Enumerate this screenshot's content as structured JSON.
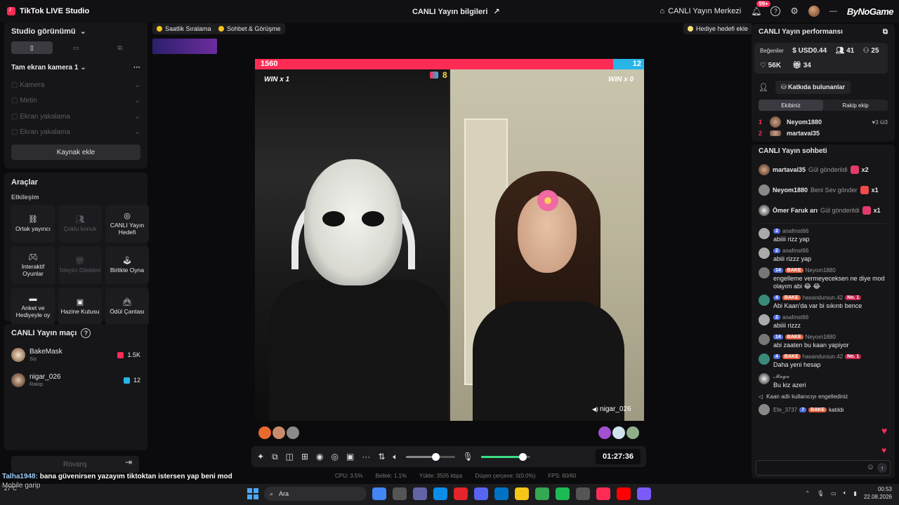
{
  "app": {
    "title": "TikTok LIVE Studio",
    "center_title": "CANLI Yayın bilgileri",
    "center_link": "CANLI Yayın Merkezi",
    "notif_badge": "99+",
    "watermark": "ByNoGame"
  },
  "studio": {
    "title": "Studio görünümü",
    "scene": "Tam ekran kamera 1",
    "sources": [
      "Kamera",
      "Metin",
      "Ekran yakalama",
      "Ekran yakalama"
    ],
    "add_source": "Kaynak ekle"
  },
  "tools": {
    "title": "Araçlar",
    "section": "Etkileşim",
    "items": [
      {
        "label": "Ortak yayıncı",
        "enabled": true,
        "icon": "link-icon"
      },
      {
        "label": "Çoklu konuk",
        "enabled": false,
        "icon": "users-icon"
      },
      {
        "label": "CANLI Yayın Hedefi",
        "enabled": true,
        "icon": "target-icon"
      },
      {
        "label": "İnteraktif Oyunlar",
        "enabled": true,
        "icon": "gamepad-icon"
      },
      {
        "label": "İzleyici Dilekleri",
        "enabled": false,
        "icon": "gift-icon"
      },
      {
        "label": "Birlikte Oyna",
        "enabled": true,
        "icon": "joystick-icon"
      },
      {
        "label": "Anket ve Hediyeyle oy",
        "enabled": true,
        "icon": "poll-icon"
      },
      {
        "label": "Hazine Kutusu",
        "enabled": true,
        "icon": "treasure-icon"
      },
      {
        "label": "Ödül Çantası",
        "enabled": true,
        "icon": "bag-icon"
      }
    ]
  },
  "match": {
    "title": "CANLI Yayın maçı",
    "players": [
      {
        "name": "BakeMask",
        "role": "Siz",
        "score": "1.5K",
        "color": "#fe2c55"
      },
      {
        "name": "nigar_026",
        "role": "Rakip",
        "score": "12",
        "color": "#27b5e8"
      }
    ],
    "rematch": "Rövanş"
  },
  "chips": {
    "hourly": "Saatlik Sıralama",
    "chat": "Sohbet & Görüşme",
    "gift_goal": "Hediye hedefi ekle"
  },
  "battle": {
    "score_left": "1560",
    "score_right": "12",
    "left_share": 0.92,
    "mid_count": "8",
    "win_left": "WIN x 1",
    "win_right": "WIN x 0",
    "guest_name": "nigar_026"
  },
  "controls": {
    "timer": "01:27:36",
    "volume_level": 0.6,
    "mic_level": 0.85
  },
  "stats": {
    "cpu": "CPU:  3.5%",
    "memory": "Bellek:  1.1%",
    "upload": "Yükle:  3505 kbps",
    "dropped": "Düşen çerçeve:  0(0.0%)",
    "fps": "FPS:  60/60"
  },
  "performance": {
    "title": "CANLI Yayın performansı",
    "likes_label": "Beğeniler",
    "usd": "USD0.44",
    "viewers": "41",
    "members": "25",
    "likes": "56K",
    "gifts": "34",
    "contributors": "Katkıda bulunanlar",
    "tab_ours": "Ekibiniz",
    "tab_rival": "Rakip ekip",
    "ranks": [
      {
        "rank": "1",
        "name": "Neyom1880",
        "stat": "♥3  ⛁3"
      },
      {
        "rank": "2",
        "name": "martaval35",
        "stat": ""
      }
    ]
  },
  "chat": {
    "title": "CANLI Yayın sohbeti",
    "gifts": [
      {
        "user": "martaval35",
        "text": "Gül gönderildi",
        "count": "x2"
      },
      {
        "user": "Neyom1880",
        "text": "Beni Sev gönder",
        "count": "x1"
      },
      {
        "user": "Ömer Faruk arı",
        "text": "Gül gönderildi",
        "count": "x1"
      }
    ],
    "messages": [
      {
        "level": "2",
        "fan": "",
        "no1": "",
        "user": "anafmst66",
        "text": "abiiii rizz yap"
      },
      {
        "level": "2",
        "fan": "",
        "no1": "",
        "user": "anafmst66",
        "text": "abiii rizzz yap"
      },
      {
        "level": "14",
        "fan": "BAKE",
        "no1": "",
        "user": "Neyom1880",
        "text": "engelleme vermeyeceksen ne diye mod olayım abi 😂 😂"
      },
      {
        "level": "4",
        "fan": "BAKE",
        "no1": "No. 1",
        "user": "hasandursun.42",
        "text": "Abi Kaan'da var bi sıkıntı bence"
      },
      {
        "level": "2",
        "fan": "",
        "no1": "",
        "user": "anafmst66",
        "text": "abiiii rizzz"
      },
      {
        "level": "14",
        "fan": "BAKE",
        "no1": "",
        "user": "Neyom1880",
        "text": "abi zaaten bu kaan yapiyor"
      },
      {
        "level": "4",
        "fan": "BAKE",
        "no1": "No. 1",
        "user": "hasandursun.42",
        "text": "Daha yeni hesap"
      },
      {
        "level": "",
        "fan": "",
        "no1": "",
        "user": "𝓜𝓪𝓰𝓪",
        "text": "Bu kiz azeri"
      }
    ],
    "system": "Kaan adlı kullanıcıyı engellediniz",
    "last": {
      "user": "Efe_3737",
      "level": "7",
      "fan": "BAKE",
      "text": "katıldı"
    }
  },
  "overlay": {
    "user": "Talha1948:",
    "text": " bana güvenirsen yazayım tiktoktan istersen yap beni mod",
    "sub": "Mobile garip"
  },
  "taskbar": {
    "search": "Ara",
    "temp": "27°C",
    "time": "00:53",
    "date": "22.08.2026"
  }
}
